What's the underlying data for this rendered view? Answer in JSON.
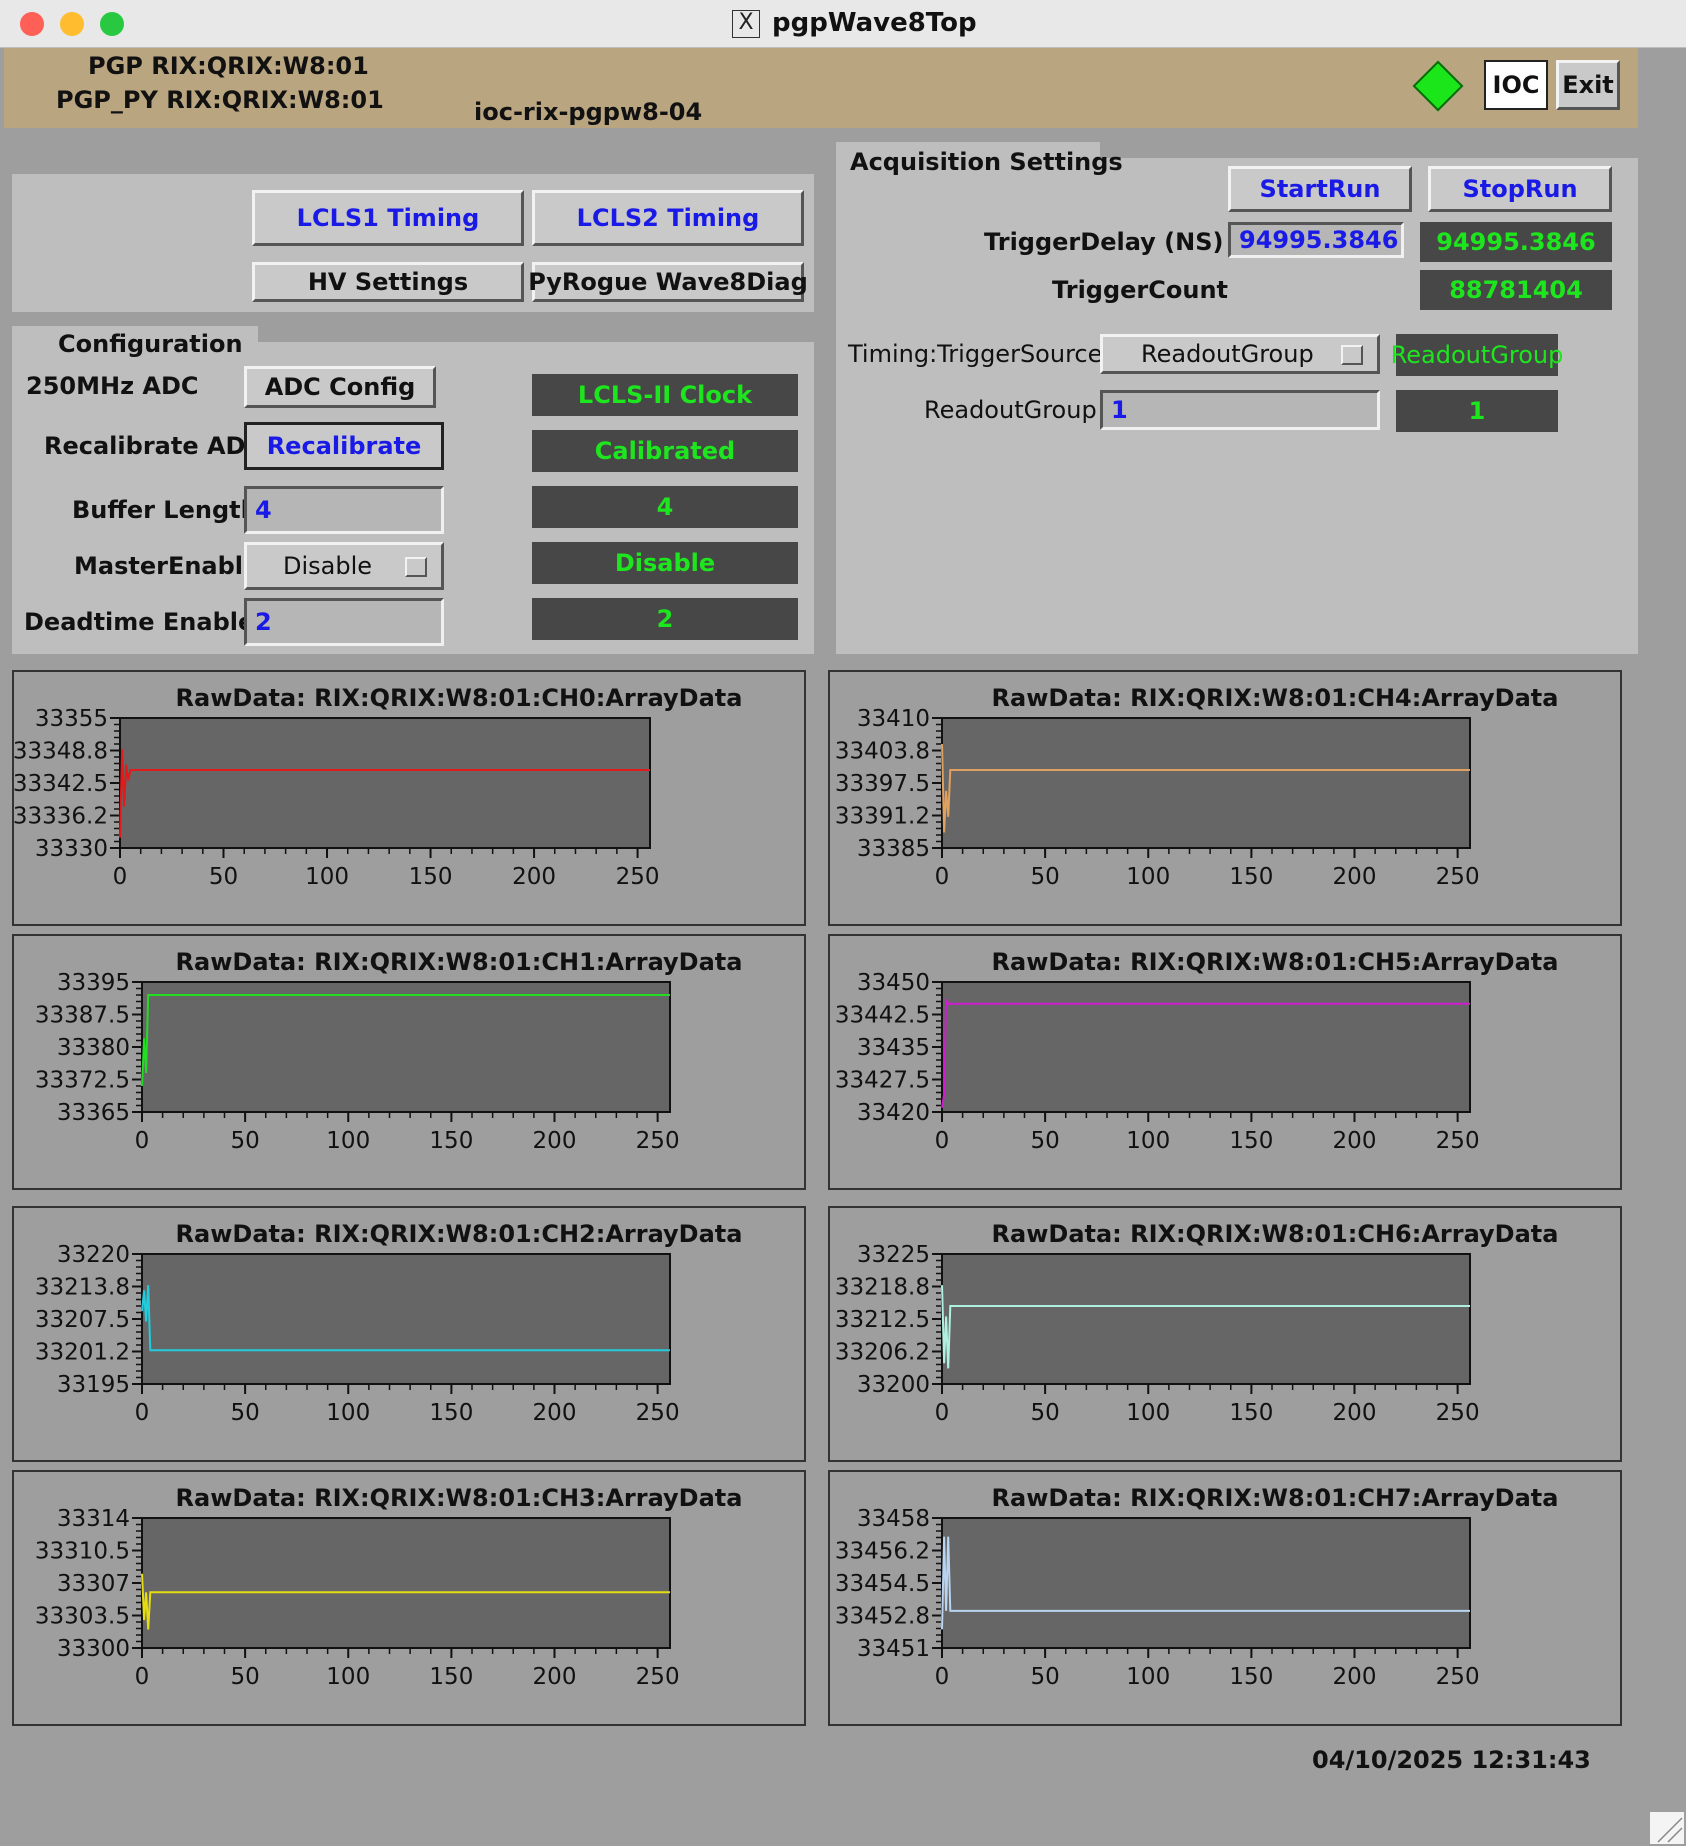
{
  "window": {
    "title": "pgpWave8Top",
    "x_icon": "X"
  },
  "header": {
    "pgp_label": "PGP RIX:QRIX:W8:01",
    "pgp_py_label": "PGP_PY RIX:QRIX:W8:01",
    "ioc_host": "ioc-rix-pgpw8-04",
    "status_color": "#1ae61a",
    "ioc_button": "IOC",
    "exit_button": "Exit"
  },
  "timing": {
    "lcls1": "LCLS1  Timing",
    "lcls2": "LCLS2  Timing",
    "hv": "HV Settings",
    "pyrogue": "PyRogue Wave8Diag"
  },
  "config": {
    "title": "Configuration",
    "adc_label": "250MHz ADC",
    "adc_button": "ADC Config",
    "adc_readback": "LCLS-II Clock",
    "recal_label": "Recalibrate ADC",
    "recal_button": "Recalibrate",
    "recal_readback": "Calibrated",
    "buffer_label": "Buffer Length",
    "buffer_value": "4",
    "buffer_readback": "4",
    "master_label": "MasterEnable",
    "master_value": "Disable",
    "master_readback": "Disable",
    "deadtime_label": "Deadtime Enables",
    "deadtime_value": "2",
    "deadtime_readback": "2"
  },
  "acquisition": {
    "title": "Acquisition Settings",
    "start": "StartRun",
    "stop": "StopRun",
    "delay_label": "TriggerDelay (NS)",
    "delay_value": "94995.3846",
    "delay_readback": "94995.3846",
    "count_label": "TriggerCount",
    "count_readback": "88781404",
    "source_label": "Timing:TriggerSource",
    "source_value": "ReadoutGroup",
    "source_readback": "ReadoutGroup",
    "group_label": "ReadoutGroup",
    "group_value": "1",
    "group_readback": "1"
  },
  "plots": {
    "ch0": {
      "title": "RawData: RIX:QRIX:W8:01:CH0:ArrayData"
    },
    "ch1": {
      "title": "RawData: RIX:QRIX:W8:01:CH1:ArrayData"
    },
    "ch2": {
      "title": "RawData: RIX:QRIX:W8:01:CH2:ArrayData"
    },
    "ch3": {
      "title": "RawData: RIX:QRIX:W8:01:CH3:ArrayData"
    },
    "ch4": {
      "title": "RawData: RIX:QRIX:W8:01:CH4:ArrayData"
    },
    "ch5": {
      "title": "RawData: RIX:QRIX:W8:01:CH5:ArrayData"
    },
    "ch6": {
      "title": "RawData: RIX:QRIX:W8:01:CH6:ArrayData"
    },
    "ch7": {
      "title": "RawData: RIX:QRIX:W8:01:CH7:ArrayData"
    }
  },
  "chart_data": [
    {
      "type": "line",
      "title": "RawData: RIX:QRIX:W8:01:CH0:ArrayData",
      "xlim": [
        0,
        256
      ],
      "ylim": [
        33330,
        33355
      ],
      "yticks": [
        "33355",
        "33348.8",
        "33342.5",
        "33336.2",
        "33330"
      ],
      "xticks": [
        "0",
        "50",
        "100",
        "150",
        "200",
        "250"
      ],
      "color": "#e41a1a",
      "x": [
        0,
        1,
        2,
        3,
        4,
        5,
        256
      ],
      "y": [
        33332,
        33349,
        33338,
        33346,
        33343,
        33345,
        33345
      ]
    },
    {
      "type": "line",
      "title": "RawData: RIX:QRIX:W8:01:CH1:ArrayData",
      "xlim": [
        0,
        256
      ],
      "ylim": [
        33365,
        33395
      ],
      "yticks": [
        "33395",
        "33387.5",
        "33380",
        "33372.5",
        "33365"
      ],
      "xticks": [
        "0",
        "50",
        "100",
        "150",
        "200",
        "250"
      ],
      "color": "#22dd22",
      "x": [
        0,
        1,
        2,
        3,
        4,
        256
      ],
      "y": [
        33371,
        33382,
        33374,
        33392,
        33392,
        33392
      ]
    },
    {
      "type": "line",
      "title": "RawData: RIX:QRIX:W8:01:CH2:ArrayData",
      "xlim": [
        0,
        256
      ],
      "ylim": [
        33195,
        33220
      ],
      "yticks": [
        "33220",
        "33213.8",
        "33207.5",
        "33201.2",
        "33195"
      ],
      "xticks": [
        "0",
        "50",
        "100",
        "150",
        "200",
        "250"
      ],
      "color": "#22ccdd",
      "x": [
        0,
        1,
        2,
        3,
        4,
        256
      ],
      "y": [
        33209,
        33213,
        33207,
        33214,
        33201.5,
        33201.5
      ]
    },
    {
      "type": "line",
      "title": "RawData: RIX:QRIX:W8:01:CH3:ArrayData",
      "xlim": [
        0,
        256
      ],
      "ylim": [
        33300,
        33314
      ],
      "yticks": [
        "33314",
        "33310.5",
        "33307",
        "33303.5",
        "33300"
      ],
      "xticks": [
        "0",
        "50",
        "100",
        "150",
        "200",
        "250"
      ],
      "color": "#e6dd11",
      "x": [
        0,
        1,
        2,
        3,
        4,
        256
      ],
      "y": [
        33308,
        33303,
        33306,
        33302,
        33306,
        33306
      ]
    },
    {
      "type": "line",
      "title": "RawData: RIX:QRIX:W8:01:CH4:ArrayData",
      "xlim": [
        0,
        256
      ],
      "ylim": [
        33385,
        33410
      ],
      "yticks": [
        "33410",
        "33403.8",
        "33397.5",
        "33391.2",
        "33385"
      ],
      "xticks": [
        "0",
        "50",
        "100",
        "150",
        "200",
        "250"
      ],
      "color": "#e0a060",
      "x": [
        0,
        1,
        2,
        3,
        4,
        256
      ],
      "y": [
        33405,
        33388,
        33396,
        33391,
        33400,
        33400
      ]
    },
    {
      "type": "line",
      "title": "RawData: RIX:QRIX:W8:01:CH5:ArrayData",
      "xlim": [
        0,
        256
      ],
      "ylim": [
        33420,
        33450
      ],
      "yticks": [
        "33450",
        "33442.5",
        "33435",
        "33427.5",
        "33420"
      ],
      "xticks": [
        "0",
        "50",
        "100",
        "150",
        "200",
        "250"
      ],
      "color": "#d01ad0",
      "x": [
        0,
        1,
        2,
        3,
        4,
        256
      ],
      "y": [
        33421,
        33424,
        33446,
        33445,
        33445,
        33445
      ]
    },
    {
      "type": "line",
      "title": "RawData: RIX:QRIX:W8:01:CH6:ArrayData",
      "xlim": [
        0,
        256
      ],
      "ylim": [
        33200,
        33225
      ],
      "yticks": [
        "33225",
        "33218.8",
        "33212.5",
        "33206.2",
        "33200"
      ],
      "xticks": [
        "0",
        "50",
        "100",
        "150",
        "200",
        "250"
      ],
      "color": "#b0f0e0",
      "x": [
        0,
        1,
        2,
        3,
        4,
        256
      ],
      "y": [
        33219,
        33204,
        33213,
        33203,
        33215,
        33215
      ]
    },
    {
      "type": "line",
      "title": "RawData: RIX:QRIX:W8:01:CH7:ArrayData",
      "xlim": [
        0,
        256
      ],
      "ylim": [
        33451,
        33458
      ],
      "yticks": [
        "33458",
        "33456.2",
        "33454.5",
        "33452.8",
        "33451"
      ],
      "xticks": [
        "0",
        "50",
        "100",
        "150",
        "200",
        "250"
      ],
      "color": "#b8d4f0",
      "x": [
        0,
        1,
        2,
        3,
        4,
        256
      ],
      "y": [
        33452,
        33457,
        33453,
        33457,
        33453,
        33453
      ]
    }
  ],
  "timestamp": "04/10/2025 12:31:43"
}
